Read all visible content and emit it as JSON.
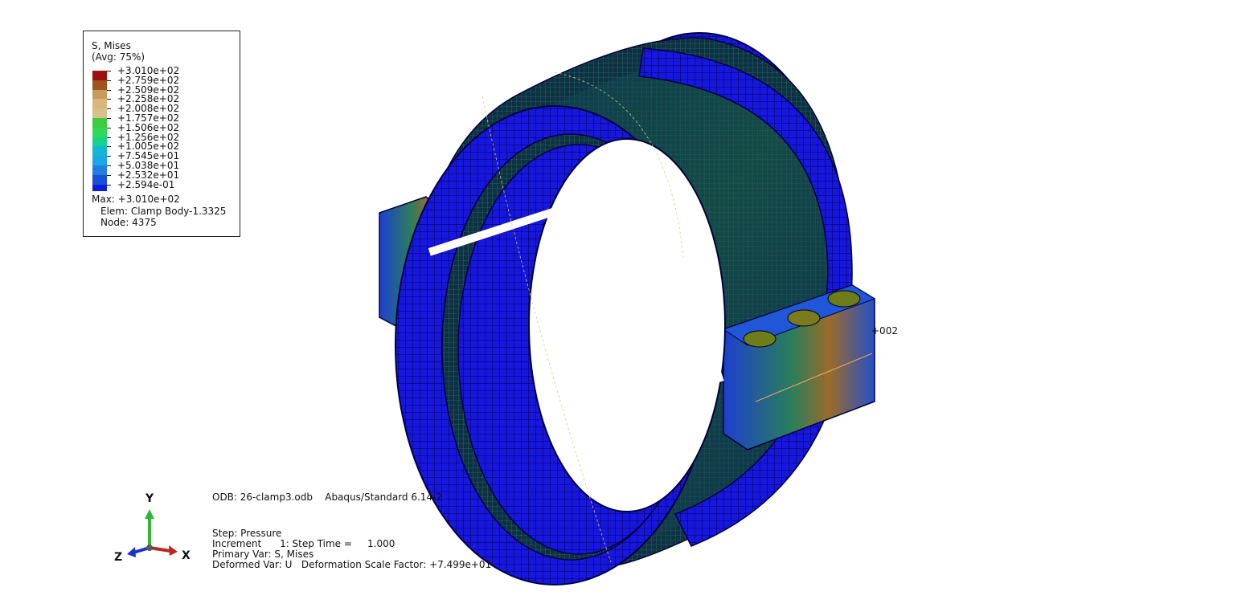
{
  "legend": {
    "title": "S, Mises",
    "subtitle": "(Avg: 75%)",
    "levels": [
      {
        "label": "+3.010e+02",
        "color": "#9b1010"
      },
      {
        "label": "+2.759e+02",
        "color": "#a0531a"
      },
      {
        "label": "+2.509e+02",
        "color": "#c99a5a"
      },
      {
        "label": "+2.258e+02",
        "color": "#d7b77b"
      },
      {
        "label": "+2.008e+02",
        "color": "#d9c08a"
      },
      {
        "label": "+1.757e+02",
        "color": "#3ecb3e"
      },
      {
        "label": "+1.506e+02",
        "color": "#2fd857"
      },
      {
        "label": "+1.256e+02",
        "color": "#14d38a"
      },
      {
        "label": "+1.005e+02",
        "color": "#13b6d4"
      },
      {
        "label": "+7.545e+01",
        "color": "#1aa8e4"
      },
      {
        "label": "+5.038e+01",
        "color": "#1f7ee0"
      },
      {
        "label": "+2.532e+01",
        "color": "#1a4fd8"
      },
      {
        "label": "+2.594e-01",
        "color": "#0a1ed8"
      }
    ],
    "max_line": "Max: +3.010e+02",
    "elem_line": "Elem: Clamp Body-1.3325",
    "node_line": "Node: 4375"
  },
  "floating_label": "+002",
  "info": {
    "odb": "ODB: 26-clamp3.odb    Abaqus/Standard 6.14-2",
    "step": "Step: Pressure",
    "increment": "Increment      1: Step Time =     1.000",
    "primary_var": "Primary Var: S, Mises",
    "deformed_var": "Deformed Var: U   Deformation Scale Factor: +7.499e+01"
  },
  "triad": {
    "y_label": "Y",
    "x_label": "X",
    "z_label": "Z",
    "y_color": "#2fb82f",
    "x_color": "#b52a1c",
    "z_color": "#1a2fd0"
  },
  "colors": {
    "mesh_blue": "#1a1adf",
    "mesh_dark": "#0e2a44",
    "mesh_line": "#000033"
  }
}
